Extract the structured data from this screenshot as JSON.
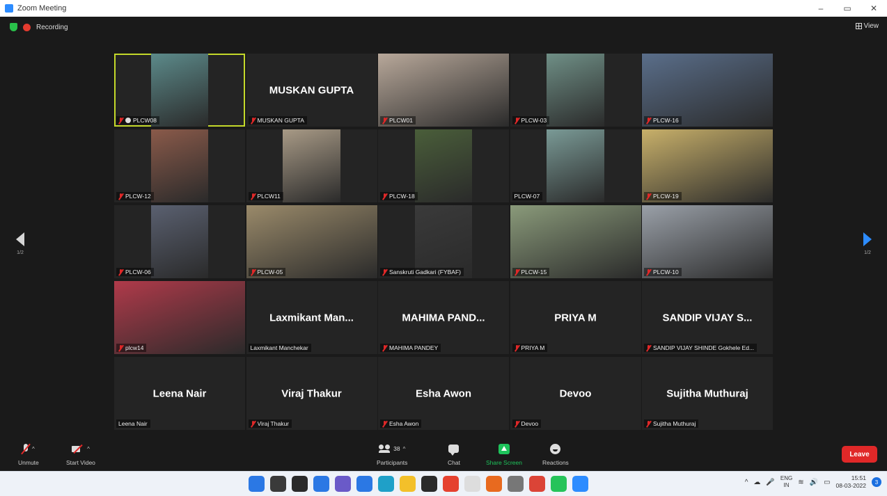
{
  "window": {
    "title": "Zoom Meeting",
    "minimize_glyph": "–",
    "restore_glyph": "▭",
    "close_glyph": "✕"
  },
  "status": {
    "recording_label": "Recording",
    "view_label": "View"
  },
  "pagination": {
    "prev_page_label": "1/2",
    "next_page_label": "1/2"
  },
  "participants": [
    {
      "tile_name": "",
      "label": "PLCW08",
      "muted": true,
      "host": true,
      "video": true,
      "bg": "#5c8a8a",
      "active": true
    },
    {
      "tile_name": "MUSKAN GUPTA",
      "label": "MUSKAN GUPTA",
      "muted": true,
      "video": false
    },
    {
      "tile_name": "",
      "label": "PLCW01",
      "muted": true,
      "video": true,
      "bg": "#b8a89a"
    },
    {
      "tile_name": "",
      "label": "PLCW-03",
      "muted": true,
      "video": true,
      "bg": "#6f8f86"
    },
    {
      "tile_name": "",
      "label": "PLCW-16",
      "muted": true,
      "video": true,
      "bg": "#5a6e8a"
    },
    {
      "tile_name": "",
      "label": "PLCW-12",
      "muted": true,
      "video": true,
      "bg": "#8a5a4a"
    },
    {
      "tile_name": "",
      "label": "PLCW11",
      "muted": true,
      "video": true,
      "bg": "#a89a86"
    },
    {
      "tile_name": "",
      "label": "PLCW-18",
      "muted": true,
      "video": true,
      "bg": "#4a5e3a"
    },
    {
      "tile_name": "",
      "label": "PLCW-07",
      "muted": false,
      "video": true,
      "bg": "#7a9a96"
    },
    {
      "tile_name": "",
      "label": "PLCW-19",
      "muted": true,
      "video": true,
      "bg": "#c8b06a"
    },
    {
      "tile_name": "",
      "label": "PLCW-06",
      "muted": true,
      "video": true,
      "bg": "#5a6070"
    },
    {
      "tile_name": "",
      "label": "PLCW-05",
      "muted": true,
      "video": true,
      "bg": "#9a8a6a"
    },
    {
      "tile_name": "",
      "label": "Sanskruti Gadkari (FYBAF)",
      "muted": true,
      "video": true,
      "bg": "#3a3a3a"
    },
    {
      "tile_name": "",
      "label": "PLCW-15",
      "muted": true,
      "video": true,
      "bg": "#8a9a7a"
    },
    {
      "tile_name": "",
      "label": "PLCW-10",
      "muted": true,
      "video": true,
      "bg": "#9aa0a8"
    },
    {
      "tile_name": "",
      "label": "plcw14",
      "muted": true,
      "video": true,
      "bg": "#b03a4a"
    },
    {
      "tile_name": "Laxmikant Man...",
      "label": "Laxmikant Manchekar",
      "muted": false,
      "video": false
    },
    {
      "tile_name": "MAHIMA PAND...",
      "label": "MAHIMA PANDEY",
      "muted": true,
      "video": false
    },
    {
      "tile_name": "PRIYA M",
      "label": "PRIYA M",
      "muted": true,
      "video": false
    },
    {
      "tile_name": "SANDIP VIJAY S...",
      "label": "SANDIP VIJAY SHINDE Gokhele Ed...",
      "muted": true,
      "video": false
    },
    {
      "tile_name": "Leena Nair",
      "label": "Leena Nair",
      "muted": false,
      "video": false
    },
    {
      "tile_name": "Viraj Thakur",
      "label": "Viraj Thakur",
      "muted": true,
      "video": false
    },
    {
      "tile_name": "Esha Awon",
      "label": "Esha Awon",
      "muted": true,
      "video": false
    },
    {
      "tile_name": "Devoo",
      "label": "Devoo",
      "muted": true,
      "video": false
    },
    {
      "tile_name": "Sujitha Muthuraj",
      "label": "Sujitha Muthuraj",
      "muted": true,
      "video": false
    }
  ],
  "toolbar": {
    "unmute_label": "Unmute",
    "start_video_label": "Start Video",
    "participants_label": "Participants",
    "participants_count": "38",
    "chat_label": "Chat",
    "share_screen_label": "Share Screen",
    "reactions_label": "Reactions",
    "leave_label": "Leave",
    "caret": "^"
  },
  "taskbar": {
    "apps": [
      {
        "name": "start-icon",
        "color": "#2b78e4"
      },
      {
        "name": "search-icon",
        "color": "#3a3a3a"
      },
      {
        "name": "task-view-icon",
        "color": "#2a2a2a"
      },
      {
        "name": "widgets-icon",
        "color": "#2b78e4"
      },
      {
        "name": "teams-chat-icon",
        "color": "#6a5ac8"
      },
      {
        "name": "store-icon",
        "color": "#2b78e4"
      },
      {
        "name": "edge-icon",
        "color": "#1fa0c8"
      },
      {
        "name": "file-explorer-icon",
        "color": "#f3c02a"
      },
      {
        "name": "dropbox-icon",
        "color": "#2a2a2a"
      },
      {
        "name": "chrome-icon",
        "color": "#e5412f"
      },
      {
        "name": "amazon-icon",
        "color": "#dddddd"
      },
      {
        "name": "firefox-icon",
        "color": "#e86a1f"
      },
      {
        "name": "settings-icon",
        "color": "#777777"
      },
      {
        "name": "chrome-profile-icon",
        "color": "#db4437"
      },
      {
        "name": "whatsapp-icon",
        "color": "#25c35a"
      },
      {
        "name": "zoom-icon",
        "color": "#2d8cff"
      }
    ],
    "lang_top": "ENG",
    "lang_bottom": "IN",
    "time": "15:51",
    "date": "08-03-2022",
    "notification_count": "3"
  }
}
